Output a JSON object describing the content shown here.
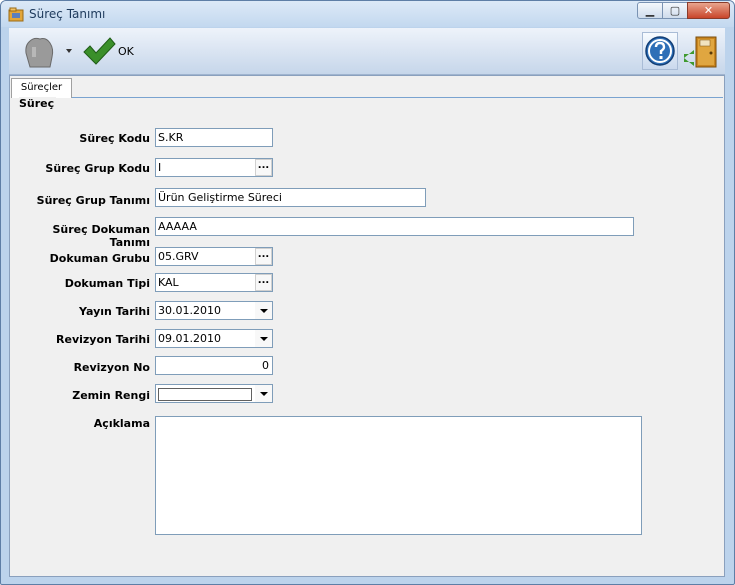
{
  "window": {
    "title": "Süreç Tanımı"
  },
  "toolbar": {
    "ok_label": "OK"
  },
  "tabs": [
    {
      "label": "Süreçler"
    }
  ],
  "group": {
    "title": "Süreç"
  },
  "form": {
    "surec_kodu": {
      "label": "Süreç Kodu",
      "value": "S.KR"
    },
    "surec_grup_kodu": {
      "label": "Süreç Grup Kodu",
      "value": "I",
      "button": "..."
    },
    "surec_grup_tanimi": {
      "label": "Süreç Grup Tanımı",
      "value": "Ürün Geliştirme Süreci"
    },
    "surec_dokuman_tanimi": {
      "label": "Süreç Dokuman Tanımı",
      "value": "AAAAA"
    },
    "dokuman_grubu": {
      "label": "Dokuman Grubu",
      "value": "05.GRV",
      "button": "..."
    },
    "dokuman_tipi": {
      "label": "Dokuman Tipi",
      "value": "KAL",
      "button": "..."
    },
    "yayin_tarihi": {
      "label": "Yayın Tarihi",
      "value": "30.01.2010"
    },
    "revizyon_tarihi": {
      "label": "Revizyon Tarihi",
      "value": "09.01.2010"
    },
    "revizyon_no": {
      "label": "Revizyon No",
      "value": "0"
    },
    "zemin_rengi": {
      "label": "Zemin Rengi",
      "value": ""
    },
    "aciklama": {
      "label": "Açıklama",
      "value": ""
    }
  },
  "colors": {
    "accent": "#2e6fb7",
    "ok_check": "#3a8f2a",
    "window_frame": "#bcd3ec"
  },
  "icons": [
    "app-folder-icon",
    "minimize-icon",
    "maximize-icon",
    "close-icon",
    "hand-icon",
    "dropdown-arrow-icon",
    "ok-check-icon",
    "help-icon",
    "exit-door-icon"
  ]
}
